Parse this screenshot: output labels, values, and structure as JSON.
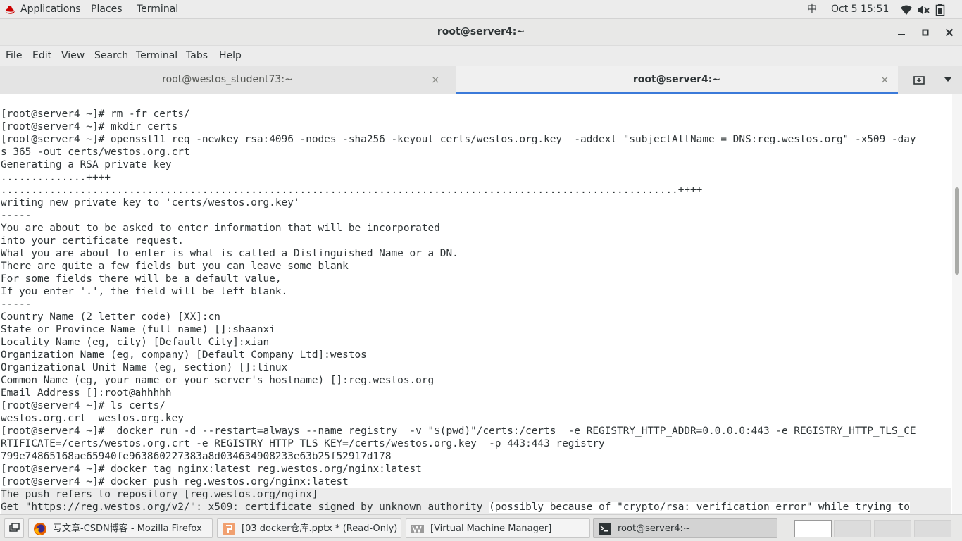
{
  "topbar": {
    "applications": "Applications",
    "places": "Places",
    "terminal": "Terminal",
    "ime": "中",
    "clock": "Oct 5  15:51"
  },
  "window": {
    "title": "root@server4:~"
  },
  "menubar": {
    "file": "File",
    "edit": "Edit",
    "view": "View",
    "search": "Search",
    "terminal": "Terminal",
    "tabs": "Tabs",
    "help": "Help"
  },
  "tabs": [
    {
      "label": "root@westos_student73:~",
      "close": "×"
    },
    {
      "label": "root@server4:~",
      "close": "×"
    }
  ],
  "terminal": {
    "lines": [
      "[root@server4 ~]# rm -fr certs/",
      "[root@server4 ~]# mkdir certs",
      "[root@server4 ~]# openssl11 req -newkey rsa:4096 -nodes -sha256 -keyout certs/westos.org.key  -addext \"subjectAltName = DNS:reg.westos.org\" -x509 -day",
      "s 365 -out certs/westos.org.crt",
      "Generating a RSA private key",
      "..............++++",
      "...............................................................................................................++++",
      "writing new private key to 'certs/westos.org.key'",
      "-----",
      "You are about to be asked to enter information that will be incorporated",
      "into your certificate request.",
      "What you are about to enter is what is called a Distinguished Name or a DN.",
      "There are quite a few fields but you can leave some blank",
      "For some fields there will be a default value,",
      "If you enter '.', the field will be left blank.",
      "-----",
      "Country Name (2 letter code) [XX]:cn",
      "State or Province Name (full name) []:shaanxi",
      "Locality Name (eg, city) [Default City]:xian",
      "Organization Name (eg, company) [Default Company Ltd]:westos",
      "Organizational Unit Name (eg, section) []:linux",
      "Common Name (eg, your name or your server's hostname) []:reg.westos.org",
      "Email Address []:root@ahhhhh",
      "[root@server4 ~]# ls certs/",
      "westos.org.crt  westos.org.key",
      "[root@server4 ~]#  docker run -d --restart=always --name registry  -v \"$(pwd)\"/certs:/certs  -e REGISTRY_HTTP_ADDR=0.0.0.0:443 -e REGISTRY_HTTP_TLS_CE",
      "RTIFICATE=/certs/westos.org.crt -e REGISTRY_HTTP_TLS_KEY=/certs/westos.org.key  -p 443:443 registry",
      "799e74865168ae65940fe963860227383a8d034634908233e63b25f52917d178",
      "[root@server4 ~]# docker tag nginx:latest reg.westos.org/nginx:latest",
      "[root@server4 ~]# docker push reg.westos.org/nginx:latest",
      "The push refers to repository [reg.westos.org/nginx]"
    ],
    "last_line_a": "Get \"https://reg.westos.org/v2/\": x509: certificate signed by unknown authority ",
    "last_line_b": "(possibly because of \"crypto/rsa: verification error\" while trying to"
  },
  "taskbar": {
    "items": [
      {
        "label": "写文章-CSDN博客 - Mozilla Firefox",
        "icon": "firefox-icon"
      },
      {
        "label": "[03 docker仓库.pptx * (Read-Only) -...",
        "icon": "impress-icon"
      },
      {
        "label": "[Virtual Machine Manager]",
        "icon": "virt-manager-icon"
      },
      {
        "label": "root@server4:~",
        "icon": "terminal-icon"
      }
    ]
  },
  "colors": {
    "accent": "#3b7ad9",
    "brand_red": "#cc0000"
  }
}
